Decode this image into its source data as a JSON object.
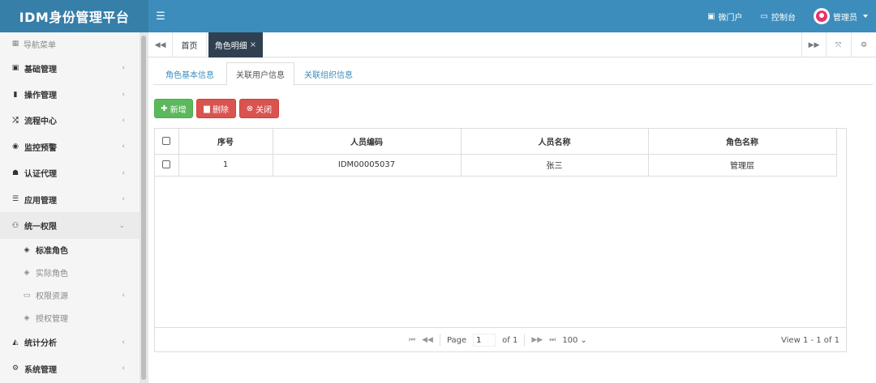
{
  "app": {
    "title": "IDM身份管理平台"
  },
  "header": {
    "links": [
      {
        "label": "微门户",
        "icon": "id-card-icon"
      },
      {
        "label": "控制台",
        "icon": "monitor-icon"
      }
    ],
    "user": {
      "name": "管理员"
    }
  },
  "sidebar": {
    "heading": "导航菜单",
    "items": [
      {
        "label": "基础管理",
        "icon": "id-card-icon"
      },
      {
        "label": "操作管理",
        "icon": "book-icon"
      },
      {
        "label": "流程中心",
        "icon": "shuffle-icon"
      },
      {
        "label": "监控预警",
        "icon": "eye-icon"
      },
      {
        "label": "认证代理",
        "icon": "users-icon"
      },
      {
        "label": "应用管理",
        "icon": "list-icon"
      },
      {
        "label": "统一权限",
        "icon": "sitemap-icon"
      }
    ],
    "subitems": [
      {
        "label": "标准角色",
        "icon": "leaf-icon"
      },
      {
        "label": "实际角色",
        "icon": "leaf-icon"
      },
      {
        "label": "权限资源",
        "icon": "folder-icon"
      },
      {
        "label": "授权管理",
        "icon": "leaf-icon"
      }
    ],
    "bottom_items": [
      {
        "label": "统计分析",
        "icon": "area-chart-icon"
      },
      {
        "label": "系统管理",
        "icon": "cogs-icon"
      }
    ]
  },
  "page_tabs": {
    "home": "首页",
    "active": "角色明细"
  },
  "inner_tabs": [
    "角色基本信息",
    "关联用户信息",
    "关联组织信息"
  ],
  "toolbar": {
    "add": "新增",
    "delete": "删除",
    "close": "关闭"
  },
  "table": {
    "headers": [
      "序号",
      "人员编码",
      "人员名称",
      "角色名称"
    ],
    "rows": [
      {
        "index": "1",
        "code": "IDM00005037",
        "name": "张三",
        "role": "管理层"
      }
    ]
  },
  "pager": {
    "page_label": "Page",
    "page_value": "1",
    "of_label": "of 1",
    "page_size": "100",
    "info": "View 1 - 1 of 1"
  },
  "colors": {
    "header": "#3c8dbc",
    "brand": "#367fa9",
    "active_tab": "#2f4050",
    "success": "#5cb85c",
    "danger": "#d9534f"
  }
}
